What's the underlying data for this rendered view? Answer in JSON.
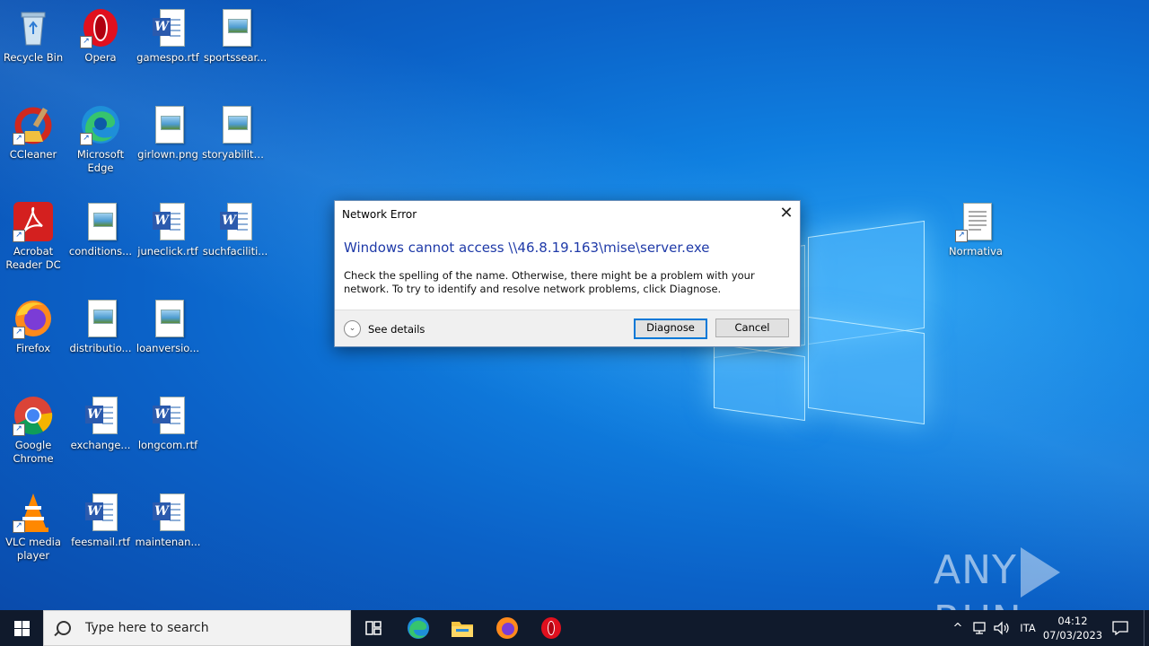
{
  "desktop": {
    "icons": [
      {
        "label": "Recycle Bin",
        "type": "recycle"
      },
      {
        "label": "Opera",
        "type": "opera"
      },
      {
        "label": "gamespo.rtf",
        "type": "word"
      },
      {
        "label": "sportssear...",
        "type": "image-doc"
      },
      {
        "label": "CCleaner",
        "type": "ccleaner"
      },
      {
        "label": "Microsoft Edge",
        "type": "edge"
      },
      {
        "label": "girlown.png",
        "type": "image-doc"
      },
      {
        "label": "storyability....",
        "type": "image-doc"
      },
      {
        "label": "Acrobat Reader DC",
        "type": "acrobat"
      },
      {
        "label": "conditions...",
        "type": "image-doc"
      },
      {
        "label": "juneclick.rtf",
        "type": "word"
      },
      {
        "label": "suchfaciliti...",
        "type": "word"
      },
      {
        "label": "Firefox",
        "type": "firefox"
      },
      {
        "label": "distributio...",
        "type": "image-doc"
      },
      {
        "label": "loanversio...",
        "type": "image-doc"
      },
      {
        "label": "Google Chrome",
        "type": "chrome"
      },
      {
        "label": "exchange...",
        "type": "word"
      },
      {
        "label": "longcom.rtf",
        "type": "word"
      },
      {
        "label": "VLC media player",
        "type": "vlc"
      },
      {
        "label": "feesmail.rtf",
        "type": "word"
      },
      {
        "label": "maintenan...",
        "type": "word"
      },
      {
        "label": "Normativa",
        "type": "text-doc"
      }
    ]
  },
  "dialog": {
    "title": "Network Error",
    "heading": "Windows cannot access \\\\46.8.19.163\\mise\\server.exe",
    "message": "Check the spelling of the name. Otherwise, there might be a problem with your network. To try to identify and resolve network problems, click Diagnose.",
    "details_label": "See details",
    "diagnose_label": "Diagnose",
    "cancel_label": "Cancel",
    "close_glyph": "✕"
  },
  "taskbar": {
    "search_placeholder": "Type here to search",
    "pinned": [
      "task-view",
      "edge",
      "file-explorer",
      "firefox",
      "opera"
    ],
    "language": "ITA",
    "time": "04:12",
    "date": "07/03/2023"
  },
  "watermark": {
    "text_left": "ANY",
    "text_right": "RUN"
  }
}
